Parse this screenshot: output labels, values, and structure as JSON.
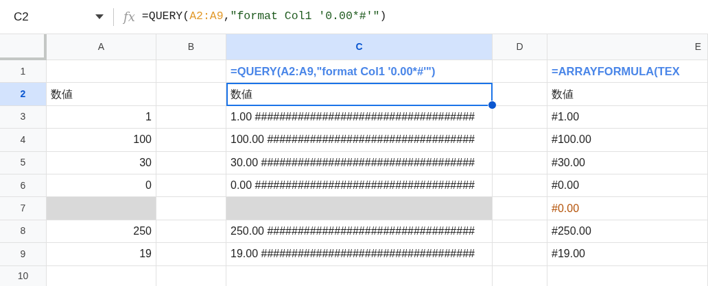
{
  "formula_bar": {
    "cell_ref": "C2",
    "fx_label": "fx",
    "formula_parts": [
      {
        "text": "=QUERY(",
        "kind": "plain"
      },
      {
        "text": "A2:A9",
        "kind": "range"
      },
      {
        "text": ",",
        "kind": "plain"
      },
      {
        "text": "\"format Col1 '0.00*#'\"",
        "kind": "string"
      },
      {
        "text": ")",
        "kind": "plain"
      }
    ]
  },
  "columns": [
    {
      "label": "A",
      "selected": false
    },
    {
      "label": "B",
      "selected": false
    },
    {
      "label": "C",
      "selected": true
    },
    {
      "label": "D",
      "selected": false
    },
    {
      "label": "E",
      "selected": false
    }
  ],
  "rows": [
    {
      "label": "1",
      "selected": false,
      "cells": [
        {
          "kind": "empty",
          "shaded": false,
          "selected": false
        },
        {
          "kind": "empty",
          "shaded": false,
          "selected": false
        },
        {
          "kind": "formula",
          "text": "=QUERY(A2:A9,\"format Col1 '0.00*#'\")",
          "shaded": false,
          "selected": false
        },
        {
          "kind": "empty",
          "shaded": false,
          "selected": false
        },
        {
          "kind": "formula",
          "text": "=ARRAYFORMULA(TEX",
          "shaded": false,
          "selected": false
        }
      ]
    },
    {
      "label": "2",
      "selected": true,
      "cells": [
        {
          "kind": "text",
          "text": "数値",
          "shaded": false,
          "selected": false
        },
        {
          "kind": "empty",
          "shaded": false,
          "selected": false
        },
        {
          "kind": "text",
          "text": "数値",
          "shaded": false,
          "selected": true
        },
        {
          "kind": "empty",
          "shaded": false,
          "selected": false
        },
        {
          "kind": "text",
          "text": "数値",
          "shaded": false,
          "selected": false
        }
      ]
    },
    {
      "label": "3",
      "selected": false,
      "cells": [
        {
          "kind": "number",
          "text": "1",
          "shaded": false,
          "selected": false
        },
        {
          "kind": "empty",
          "shaded": false,
          "selected": false
        },
        {
          "kind": "text",
          "text": "1.00  ####################################",
          "shaded": false,
          "selected": false
        },
        {
          "kind": "empty",
          "shaded": false,
          "selected": false
        },
        {
          "kind": "text",
          "text": "#1.00",
          "shaded": false,
          "selected": false
        }
      ]
    },
    {
      "label": "4",
      "selected": false,
      "cells": [
        {
          "kind": "number",
          "text": "100",
          "shaded": false,
          "selected": false
        },
        {
          "kind": "empty",
          "shaded": false,
          "selected": false
        },
        {
          "kind": "text",
          "text": "100.00  ##################################",
          "shaded": false,
          "selected": false
        },
        {
          "kind": "empty",
          "shaded": false,
          "selected": false
        },
        {
          "kind": "text",
          "text": "#100.00",
          "shaded": false,
          "selected": false
        }
      ]
    },
    {
      "label": "5",
      "selected": false,
      "cells": [
        {
          "kind": "number",
          "text": "30",
          "shaded": false,
          "selected": false
        },
        {
          "kind": "empty",
          "shaded": false,
          "selected": false
        },
        {
          "kind": "text",
          "text": "30.00  ###################################",
          "shaded": false,
          "selected": false
        },
        {
          "kind": "empty",
          "shaded": false,
          "selected": false
        },
        {
          "kind": "text",
          "text": "#30.00",
          "shaded": false,
          "selected": false
        }
      ]
    },
    {
      "label": "6",
      "selected": false,
      "cells": [
        {
          "kind": "number",
          "text": "0",
          "shaded": false,
          "selected": false
        },
        {
          "kind": "empty",
          "shaded": false,
          "selected": false
        },
        {
          "kind": "text",
          "text": "0.00  ####################################",
          "shaded": false,
          "selected": false
        },
        {
          "kind": "empty",
          "shaded": false,
          "selected": false
        },
        {
          "kind": "text",
          "text": "#0.00",
          "shaded": false,
          "selected": false
        }
      ]
    },
    {
      "label": "7",
      "selected": false,
      "cells": [
        {
          "kind": "empty",
          "shaded": true,
          "selected": false
        },
        {
          "kind": "empty",
          "shaded": false,
          "selected": false
        },
        {
          "kind": "empty",
          "shaded": true,
          "selected": false
        },
        {
          "kind": "empty",
          "shaded": false,
          "selected": false
        },
        {
          "kind": "warning",
          "text": "#0.00",
          "shaded": false,
          "selected": false
        }
      ]
    },
    {
      "label": "8",
      "selected": false,
      "cells": [
        {
          "kind": "number",
          "text": "250",
          "shaded": false,
          "selected": false
        },
        {
          "kind": "empty",
          "shaded": false,
          "selected": false
        },
        {
          "kind": "text",
          "text": "250.00  ##################################",
          "shaded": false,
          "selected": false
        },
        {
          "kind": "empty",
          "shaded": false,
          "selected": false
        },
        {
          "kind": "text",
          "text": "#250.00",
          "shaded": false,
          "selected": false
        }
      ]
    },
    {
      "label": "9",
      "selected": false,
      "cells": [
        {
          "kind": "number",
          "text": "19",
          "shaded": false,
          "selected": false
        },
        {
          "kind": "empty",
          "shaded": false,
          "selected": false
        },
        {
          "kind": "text",
          "text": "19.00  ###################################",
          "shaded": false,
          "selected": false
        },
        {
          "kind": "empty",
          "shaded": false,
          "selected": false
        },
        {
          "kind": "text",
          "text": "#19.00",
          "shaded": false,
          "selected": false
        }
      ]
    },
    {
      "label": "10",
      "selected": false,
      "cells": [
        {
          "kind": "empty",
          "shaded": false,
          "selected": false
        },
        {
          "kind": "empty",
          "shaded": false,
          "selected": false
        },
        {
          "kind": "empty",
          "shaded": false,
          "selected": false
        },
        {
          "kind": "empty",
          "shaded": false,
          "selected": false
        },
        {
          "kind": "empty",
          "shaded": false,
          "selected": false
        }
      ]
    }
  ]
}
